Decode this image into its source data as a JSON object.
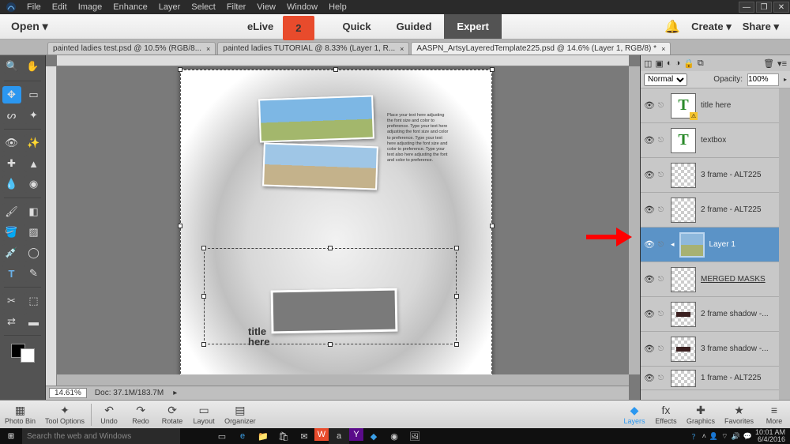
{
  "menubar": [
    "File",
    "Edit",
    "Image",
    "Enhance",
    "Layer",
    "Select",
    "Filter",
    "View",
    "Window",
    "Help"
  ],
  "modebar": {
    "open": "Open",
    "modes": [
      "eLive",
      "Quick",
      "Guided",
      "Expert"
    ],
    "active": "Expert",
    "elive_badge": "2",
    "create": "Create",
    "share": "Share"
  },
  "tabs": [
    {
      "label": "painted ladies test.psd @ 10.5% (RGB/8...",
      "active": false
    },
    {
      "label": "painted ladies TUTORIAL @ 8.33% (Layer 1, R...",
      "active": false
    },
    {
      "label": "AASPN_ArtsyLayeredTemplate225.psd @ 14.6% (Layer 1, RGB/8) *",
      "active": true
    }
  ],
  "canvas": {
    "zoom": "14.61%",
    "doc": "Doc: 37.1M/183.7M",
    "title_text": "title\nhere",
    "lorem": "Place your text here adjusting the font size and color to preference. Type your text here adjusting the font size and color to preference. Type your text here adjusting the font size and color to preference. Type your text also here adjusting the font and color to preference."
  },
  "layers_panel": {
    "blend_mode": "Normal",
    "opacity_label": "Opacity:",
    "opacity_value": "100%",
    "layers": [
      {
        "name": "title here",
        "type": "text",
        "warn": true
      },
      {
        "name": "textbox",
        "type": "text"
      },
      {
        "name": "3 frame - ALT225",
        "type": "checker"
      },
      {
        "name": "2 frame - ALT225",
        "type": "checker"
      },
      {
        "name": "Layer 1",
        "type": "image",
        "selected": true
      },
      {
        "name": "MERGED MASKS ",
        "type": "checker",
        "underline": true
      },
      {
        "name": "2 frame shadow -...",
        "type": "checker-dark"
      },
      {
        "name": "3 frame shadow -...",
        "type": "checker-dark"
      },
      {
        "name": "1 frame - ALT225",
        "type": "checker"
      }
    ]
  },
  "bottombar": {
    "left": [
      {
        "icon": "▦",
        "label": "Photo Bin"
      },
      {
        "icon": "✦",
        "label": "Tool Options"
      }
    ],
    "mid": [
      {
        "icon": "↶",
        "label": "Undo"
      },
      {
        "icon": "↷",
        "label": "Redo"
      },
      {
        "icon": "⟳",
        "label": "Rotate"
      },
      {
        "icon": "▭",
        "label": "Layout"
      },
      {
        "icon": "▤",
        "label": "Organizer"
      }
    ],
    "right": [
      {
        "icon": "◆",
        "label": "Layers"
      },
      {
        "icon": "fx",
        "label": "Effects"
      },
      {
        "icon": "✚",
        "label": "Graphics"
      },
      {
        "icon": "★",
        "label": "Favorites"
      },
      {
        "icon": "≡",
        "label": "More"
      }
    ]
  },
  "taskbar": {
    "search_placeholder": "Search the web and Windows",
    "time": "10:01 AM",
    "date": "6/4/2016"
  }
}
